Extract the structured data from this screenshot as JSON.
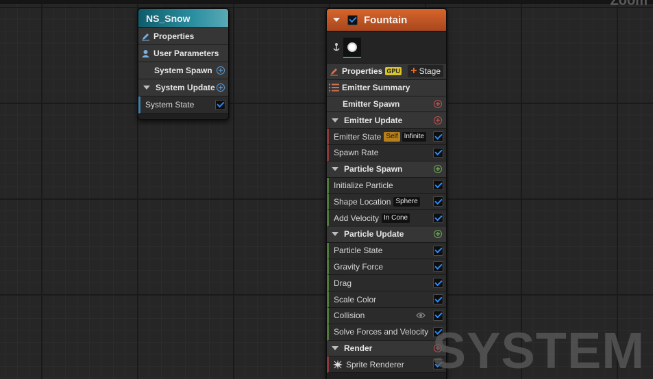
{
  "canvas": {
    "zoom_label": "Zoom",
    "watermark": "SYSTEM"
  },
  "ns_snow": {
    "title": "NS_Snow",
    "properties": "Properties",
    "user_parameters": "User Parameters",
    "system_spawn": "System Spawn",
    "system_update": "System Update",
    "modules": [
      {
        "label": "System State",
        "enabled": true
      }
    ]
  },
  "fountain": {
    "title": "Fountain",
    "enabled": true,
    "properties": "Properties",
    "gpu_badge": "GPU",
    "stage_button": "Stage",
    "emitter_summary": "Emitter Summary",
    "emitter_spawn": "Emitter Spawn",
    "emitter_update": "Emitter Update",
    "emitter_update_modules": [
      {
        "label": "Emitter State",
        "tags": [
          "Self",
          "Infinite"
        ],
        "enabled": true
      },
      {
        "label": "Spawn Rate",
        "enabled": true
      }
    ],
    "particle_spawn": "Particle Spawn",
    "particle_spawn_modules": [
      {
        "label": "Initialize Particle",
        "enabled": true
      },
      {
        "label": "Shape Location",
        "tag": "Sphere",
        "enabled": true
      },
      {
        "label": "Add Velocity",
        "tag": "In Cone",
        "enabled": true
      }
    ],
    "particle_update": "Particle Update",
    "particle_update_modules": [
      {
        "label": "Particle State",
        "enabled": true
      },
      {
        "label": "Gravity Force",
        "enabled": true
      },
      {
        "label": "Drag",
        "enabled": true
      },
      {
        "label": "Scale Color",
        "enabled": true
      },
      {
        "label": "Collision",
        "enabled": true
      },
      {
        "label": "Solve Forces and Velocity",
        "enabled": true
      }
    ],
    "render": "Render",
    "render_modules": [
      {
        "label": "Sprite Renderer",
        "enabled": true
      }
    ]
  },
  "colors": {
    "ns_snow_header": "#2a8ea0",
    "fountain_header": "#d7652a",
    "check_blue": "#2b8cff",
    "gpu_badge": "#d8c42a",
    "self_tag": "#b8801a"
  }
}
